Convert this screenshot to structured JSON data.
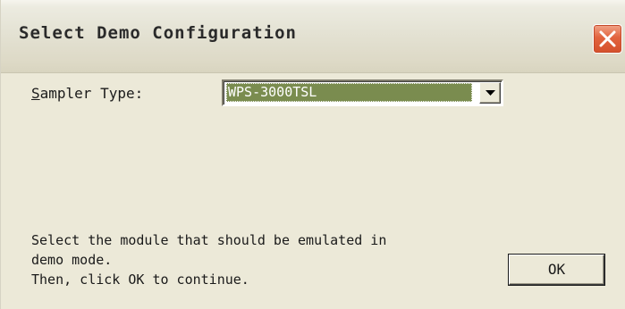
{
  "window": {
    "title": "Select Demo Configuration",
    "close_icon": "close-icon"
  },
  "form": {
    "sampler_type_label_accel": "S",
    "sampler_type_label_rest": "ampler Type:",
    "sampler_type_value": "WPS-3000TSL",
    "dropdown_icon": "chevron-down-icon"
  },
  "instructions": {
    "line1": "Select the module that should be emulated in",
    "line2": "demo mode.",
    "line3": "Then, click OK to continue."
  },
  "buttons": {
    "ok_label": "OK"
  },
  "colors": {
    "window_bg": "#ece9d8",
    "selection_bg": "#7a8c4f",
    "close_button": "#e2643f"
  }
}
